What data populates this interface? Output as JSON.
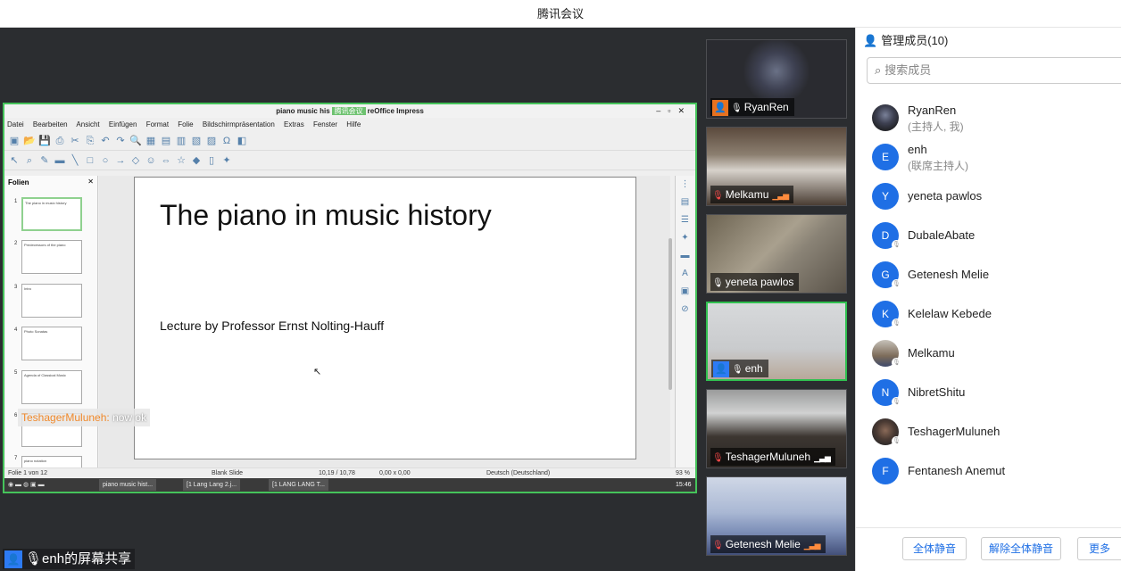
{
  "window": {
    "title": "腾讯会议"
  },
  "libreoffice": {
    "title": "piano music history.odp - LibreOffice Impress",
    "title_prefix": "piano music his",
    "title_tag": "腾讯会议",
    "title_suffix": "reOffice Impress",
    "menu": [
      "Datei",
      "Bearbeiten",
      "Ansicht",
      "Einfügen",
      "Format",
      "Folie",
      "Bildschirmpräsentation",
      "Extras",
      "Fenster",
      "Hilfe"
    ],
    "pane_title": "Folien",
    "thumbs": [
      {
        "num": "1",
        "text": "The piano in music history"
      },
      {
        "num": "2",
        "text": "Predecessors of the piano"
      },
      {
        "num": "3",
        "text": "Intro"
      },
      {
        "num": "4",
        "text": "Photo Sonatas"
      },
      {
        "num": "5",
        "text": "Agenda of Classical Music"
      },
      {
        "num": "6",
        "text": ""
      },
      {
        "num": "7",
        "text": "piano notation"
      }
    ],
    "slide": {
      "title": "The piano in music history",
      "subtitle": "Lecture by Professor Ernst Nolting-Hauff"
    },
    "status": {
      "slide": "Folie 1 von 12",
      "layout": "Blank Slide",
      "pos": "10,19 / 10,78",
      "size": "0,00 x 0,00",
      "lang": "Deutsch (Deutschland)",
      "zoom": "93 %"
    },
    "taskbar": {
      "t1": "piano music hist...",
      "t2": "[1 Lang Lang 2.j...",
      "t3": "[1 LANG LANG T...",
      "clock": "15:46"
    }
  },
  "chat": {
    "name": "TeshagerMuluneh:",
    "message": "now ok"
  },
  "sharer": {
    "label": "enh的屏幕共享"
  },
  "tiles": [
    {
      "name": "RyanRen"
    },
    {
      "name": "Melkamu"
    },
    {
      "name": "yeneta pawlos"
    },
    {
      "name": "enh"
    },
    {
      "name": "TeshagerMuluneh"
    },
    {
      "name": "Getenesh Melie"
    }
  ],
  "panel": {
    "title": "管理成员(10)",
    "search_placeholder": "搜索成员",
    "members": [
      {
        "name": "RyanRen",
        "role": "(主持人, 我)",
        "initial": ""
      },
      {
        "name": "enh",
        "role": "(联席主持人)",
        "initial": "E"
      },
      {
        "name": "yeneta pawlos",
        "role": "",
        "initial": "Y"
      },
      {
        "name": "DubaleAbate",
        "role": "",
        "initial": "D"
      },
      {
        "name": "Getenesh Melie",
        "role": "",
        "initial": "G"
      },
      {
        "name": "Kelelaw Kebede",
        "role": "",
        "initial": "K"
      },
      {
        "name": "Melkamu",
        "role": "",
        "initial": ""
      },
      {
        "name": "NibretShitu",
        "role": "",
        "initial": "N"
      },
      {
        "name": "TeshagerMuluneh",
        "role": "",
        "initial": ""
      },
      {
        "name": "Fentanesh Anemut",
        "role": "",
        "initial": "F"
      }
    ],
    "buttons": {
      "mute_all": "全体静音",
      "unmute_all": "解除全体静音",
      "more": "更多"
    }
  }
}
